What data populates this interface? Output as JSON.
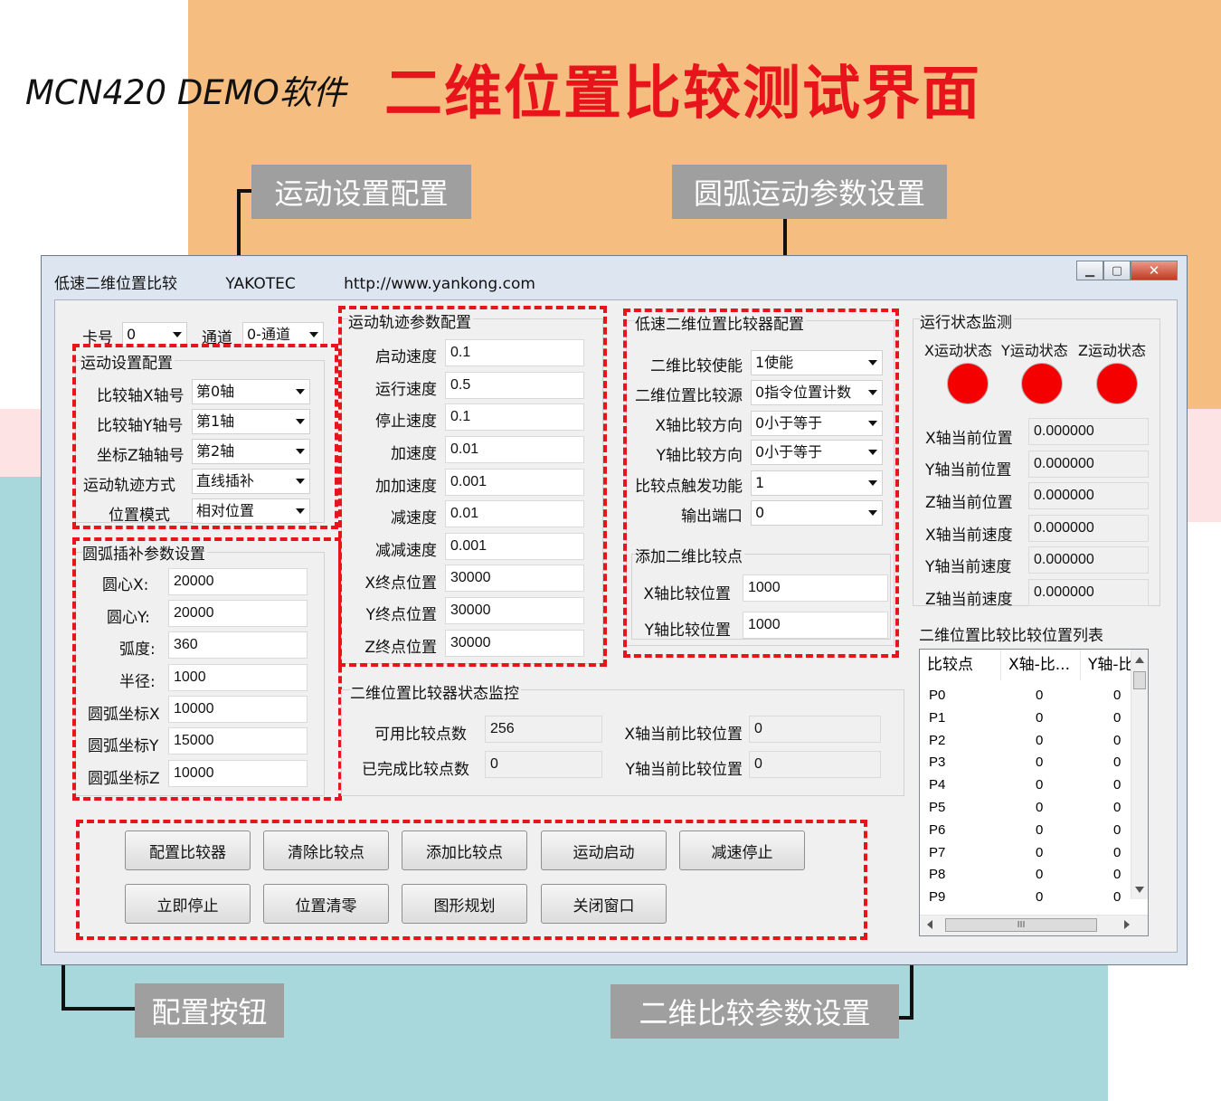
{
  "header": {
    "subtitle": "MCN420 DEMO软件",
    "title": "二维位置比较测试界面"
  },
  "callouts": {
    "motion_settings": "运动设置配置",
    "arc_params": "圆弧运动参数设置",
    "config_buttons": "配置按钮",
    "compare_params": "二维比较参数设置"
  },
  "window": {
    "title": "低速二维位置比较",
    "company": "YAKOTEC",
    "url": "http://www.yankong.com",
    "minimize": "▁",
    "maximize": "▢",
    "close": "✕"
  },
  "top": {
    "card_label": "卡号",
    "card_value": "0",
    "channel_label": "通道",
    "channel_value": "0-通道"
  },
  "motion_cfg": {
    "title": "运动设置配置",
    "x_axis_label": "比较轴X轴号",
    "x_axis_value": "第0轴",
    "y_axis_label": "比较轴Y轴号",
    "y_axis_value": "第1轴",
    "z_axis_label": "坐标Z轴轴号",
    "z_axis_value": "第2轴",
    "track_label": "运动轨迹方式",
    "track_value": "直线插补",
    "pos_mode_label": "位置模式",
    "pos_mode_value": "相对位置"
  },
  "arc": {
    "title": "圆弧插补参数设置",
    "cx_label": "圆心X:",
    "cx": "20000",
    "cy_label": "圆心Y:",
    "cy": "20000",
    "arc_label": "弧度:",
    "arc": "360",
    "radius_label": "半径:",
    "radius": "1000",
    "ax_label": "圆弧坐标X",
    "ax": "10000",
    "ay_label": "圆弧坐标Y",
    "ay": "15000",
    "az_label": "圆弧坐标Z",
    "az": "10000"
  },
  "track": {
    "title": "运动轨迹参数配置",
    "start_speed_label": "启动速度",
    "start_speed": "0.1",
    "run_speed_label": "运行速度",
    "run_speed": "0.5",
    "stop_speed_label": "停止速度",
    "stop_speed": "0.1",
    "acc_label": "加速度",
    "acc": "0.01",
    "jerk_acc_label": "加加速度",
    "jerk_acc": "0.001",
    "dec_label": "减速度",
    "dec": "0.01",
    "jerk_dec_label": "减减速度",
    "jerk_dec": "0.001",
    "x_end_label": "X终点位置",
    "x_end": "30000",
    "y_end_label": "Y终点位置",
    "y_end": "30000",
    "z_end_label": "Z终点位置",
    "z_end": "30000"
  },
  "comparator": {
    "title": "低速二维位置比较器配置",
    "enable_label": "二维比较使能",
    "enable_value": "1使能",
    "source_label": "二维位置比较源",
    "source_value": "0指令位置计数",
    "x_dir_label": "X轴比较方向",
    "x_dir_value": "0小于等于",
    "y_dir_label": "Y轴比较方向",
    "y_dir_value": "0小于等于",
    "trigger_label": "比较点触发功能",
    "trigger_value": "1",
    "port_label": "输出端口",
    "port_value": "0"
  },
  "add_point": {
    "title": "添加二维比较点",
    "x_label": "X轴比较位置",
    "x_value": "1000",
    "y_label": "Y轴比较位置",
    "y_value": "1000"
  },
  "status_monitor": {
    "title": "二维位置比较器状态监控",
    "avail_label": "可用比较点数",
    "avail_value": "256",
    "done_label": "已完成比较点数",
    "done_value": "0",
    "x_cur_label": "X轴当前比较位置",
    "x_cur_value": "0",
    "y_cur_label": "Y轴当前比较位置",
    "y_cur_value": "0"
  },
  "run_monitor": {
    "title": "运行状态监测",
    "x_state": "X运动状态",
    "y_state": "Y运动状态",
    "z_state": "Z运动状态",
    "led_color": "#f40000",
    "x_pos_label": "X轴当前位置",
    "x_pos": "0.000000",
    "y_pos_label": "Y轴当前位置",
    "y_pos": "0.000000",
    "z_pos_label": "Z轴当前位置",
    "z_pos": "0.000000",
    "x_spd_label": "X轴当前速度",
    "x_spd": "0.000000",
    "y_spd_label": "Y轴当前速度",
    "y_spd": "0.000000",
    "z_spd_label": "Z轴当前速度",
    "z_spd": "0.000000"
  },
  "point_list": {
    "title": "二维位置比较比较位置列表",
    "headers": [
      "比较点",
      "X轴-比...",
      "Y轴-比..."
    ],
    "rows": [
      [
        "P0",
        "0",
        "0"
      ],
      [
        "P1",
        "0",
        "0"
      ],
      [
        "P2",
        "0",
        "0"
      ],
      [
        "P3",
        "0",
        "0"
      ],
      [
        "P4",
        "0",
        "0"
      ],
      [
        "P5",
        "0",
        "0"
      ],
      [
        "P6",
        "0",
        "0"
      ],
      [
        "P7",
        "0",
        "0"
      ],
      [
        "P8",
        "0",
        "0"
      ],
      [
        "P9",
        "0",
        "0"
      ]
    ],
    "hscroll_grip": "III"
  },
  "buttons": {
    "config_comparator": "配置比较器",
    "clear_points": "清除比较点",
    "add_point": "添加比较点",
    "start_motion": "运动启动",
    "decel_stop": "减速停止",
    "stop_now": "立即停止",
    "zero_pos": "位置清零",
    "graph_plan": "图形规划",
    "close_window": "关闭窗口"
  },
  "colors": {
    "accent_red": "#e8141b",
    "background_orange": "#f5bd80",
    "background_teal": "#a9d8dc",
    "callout_gray": "#9f9f9f"
  }
}
